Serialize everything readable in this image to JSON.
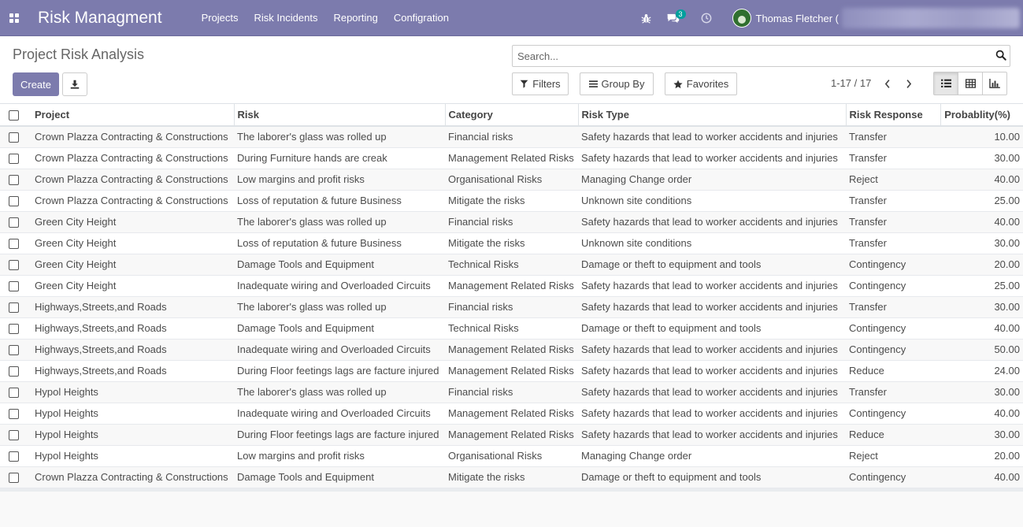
{
  "app": {
    "brand": "Risk Managment",
    "menu": [
      "Projects",
      "Risk Incidents",
      "Reporting",
      "Configration"
    ],
    "messages_count": "3",
    "user_name": "Thomas Fletcher ("
  },
  "control_panel": {
    "title": "Project Risk Analysis",
    "create_label": "Create",
    "search_placeholder": "Search...",
    "filters_label": "Filters",
    "group_by_label": "Group By",
    "favorites_label": "Favorites",
    "pager": "1-17 / 17"
  },
  "table": {
    "columns": [
      "Project",
      "Risk",
      "Category",
      "Risk Type",
      "Risk Response",
      "Probablity(%)"
    ],
    "rows": [
      [
        "Crown Plazza Contracting & Constructions",
        "The laborer's glass was rolled up",
        "Financial risks",
        "Safety hazards that lead to worker accidents and injuries",
        "Transfer",
        "10.00"
      ],
      [
        "Crown Plazza Contracting & Constructions",
        "During Furniture hands are creak",
        "Management Related Risks",
        "Safety hazards that lead to worker accidents and injuries",
        "Transfer",
        "30.00"
      ],
      [
        "Crown Plazza Contracting & Constructions",
        "Low margins and profit risks",
        "Organisational Risks",
        "Managing Change order",
        "Reject",
        "40.00"
      ],
      [
        "Crown Plazza Contracting & Constructions",
        "Loss of reputation & future Business",
        "Mitigate the risks",
        "Unknown site conditions",
        "Transfer",
        "25.00"
      ],
      [
        "Green City Height",
        "The laborer's glass was rolled up",
        "Financial risks",
        "Safety hazards that lead to worker accidents and injuries",
        "Transfer",
        "40.00"
      ],
      [
        "Green City Height",
        "Loss of reputation & future Business",
        "Mitigate the risks",
        "Unknown site conditions",
        "Transfer",
        "30.00"
      ],
      [
        "Green City Height",
        "Damage Tools and Equipment",
        "Technical Risks",
        "Damage or theft to equipment and tools",
        "Contingency",
        "20.00"
      ],
      [
        "Green City Height",
        "Inadequate wiring and Overloaded Circuits",
        "Management Related Risks",
        "Safety hazards that lead to worker accidents and injuries",
        "Contingency",
        "25.00"
      ],
      [
        "Highways,Streets,and Roads",
        "The laborer's glass was rolled up",
        "Financial risks",
        "Safety hazards that lead to worker accidents and injuries",
        "Transfer",
        "30.00"
      ],
      [
        "Highways,Streets,and Roads",
        "Damage Tools and Equipment",
        "Technical Risks",
        "Damage or theft to equipment and tools",
        "Contingency",
        "40.00"
      ],
      [
        "Highways,Streets,and Roads",
        "Inadequate wiring and Overloaded Circuits",
        "Management Related Risks",
        "Safety hazards that lead to worker accidents and injuries",
        "Contingency",
        "50.00"
      ],
      [
        "Highways,Streets,and Roads",
        "During Floor feetings lags are facture injured",
        "Management Related Risks",
        "Safety hazards that lead to worker accidents and injuries",
        "Reduce",
        "24.00"
      ],
      [
        "Hypol Heights",
        "The laborer's glass was rolled up",
        "Financial risks",
        "Safety hazards that lead to worker accidents and injuries",
        "Transfer",
        "30.00"
      ],
      [
        "Hypol Heights",
        "Inadequate wiring and Overloaded Circuits",
        "Management Related Risks",
        "Safety hazards that lead to worker accidents and injuries",
        "Contingency",
        "40.00"
      ],
      [
        "Hypol Heights",
        "During Floor feetings lags are facture injured",
        "Management Related Risks",
        "Safety hazards that lead to worker accidents and injuries",
        "Reduce",
        "30.00"
      ],
      [
        "Hypol Heights",
        "Low margins and profit risks",
        "Organisational Risks",
        "Managing Change order",
        "Reject",
        "20.00"
      ],
      [
        "Crown Plazza Contracting & Constructions",
        "Damage Tools and Equipment",
        "Mitigate the risks",
        "Damage or theft to equipment and tools",
        "Contingency",
        "40.00"
      ]
    ]
  },
  "colors": {
    "navbar": "#7c7bad",
    "primary_button": "#7c7bad",
    "badge": "#00a09d"
  }
}
